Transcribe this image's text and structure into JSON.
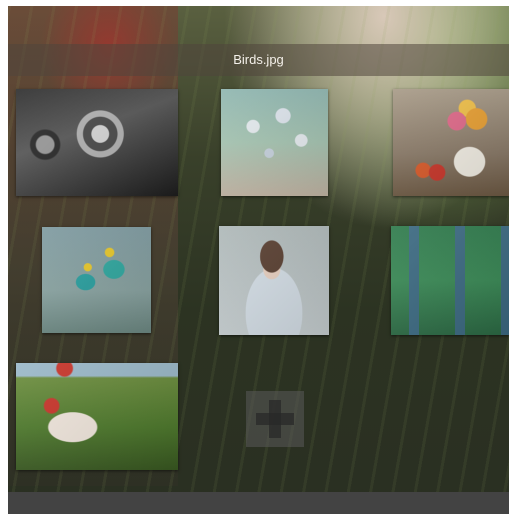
{
  "window": {
    "title": "Birds.jpg"
  },
  "gallery": {
    "thumbnails": [
      {
        "subject": "vintage-camera"
      },
      {
        "subject": "white-flowers"
      },
      {
        "subject": "flowers-in-vase-with-apples"
      },
      {
        "subject": "bee-eater-birds"
      },
      {
        "subject": "girl-in-sweater"
      },
      {
        "subject": "green-house-facade"
      },
      {
        "subject": "girl-in-wheat-field"
      }
    ],
    "add_button_icon": "plus-icon"
  },
  "colors": {
    "title_bar": "#50463c",
    "bottom_bar": "#434343",
    "add_button": "#5a5a5a"
  }
}
